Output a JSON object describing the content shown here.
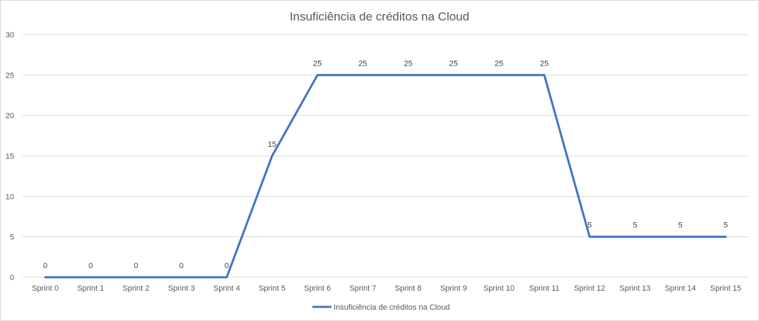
{
  "chart_data": {
    "type": "line",
    "title": "Insuficiência de créditos na Cloud",
    "categories": [
      "Sprint 0",
      "Sprint 1",
      "Sprint 2",
      "Sprint 3",
      "Sprint 4",
      "Sprint 5",
      "Sprint 6",
      "Sprint 7",
      "Sprint 8",
      "Sprint 9",
      "Sprint 10",
      "Sprint 11",
      "Sprint 12",
      "Sprint 13",
      "Sprint 14",
      "Sprint 15"
    ],
    "series": [
      {
        "name": "Insuficiência de créditos na Cloud",
        "values": [
          0,
          0,
          0,
          0,
          0,
          15,
          25,
          25,
          25,
          25,
          25,
          25,
          5,
          5,
          5,
          5
        ],
        "color": "#4472C4"
      }
    ],
    "ylim": [
      0,
      30
    ],
    "yticks": [
      0,
      5,
      10,
      15,
      20,
      25,
      30
    ],
    "grid": true,
    "legend": "bottom",
    "xlabel": "",
    "ylabel": ""
  }
}
